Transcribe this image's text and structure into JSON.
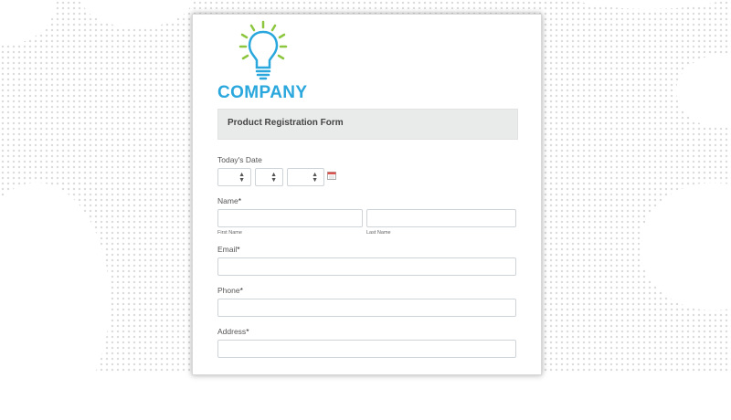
{
  "brand": {
    "name": "COMPANY",
    "logo": "lightbulb-icon",
    "accent": "#2aa7dc",
    "ray_color": "#8cc63f"
  },
  "form": {
    "title": "Product Registration Form",
    "date_label": "Today's Date",
    "date_icon": "calendar-icon",
    "name_label": "Name",
    "first_name_sublabel": "First Name",
    "last_name_sublabel": "Last Name",
    "email_label": "Email",
    "phone_label": "Phone",
    "address_label": "Address",
    "required_mark": "*"
  }
}
